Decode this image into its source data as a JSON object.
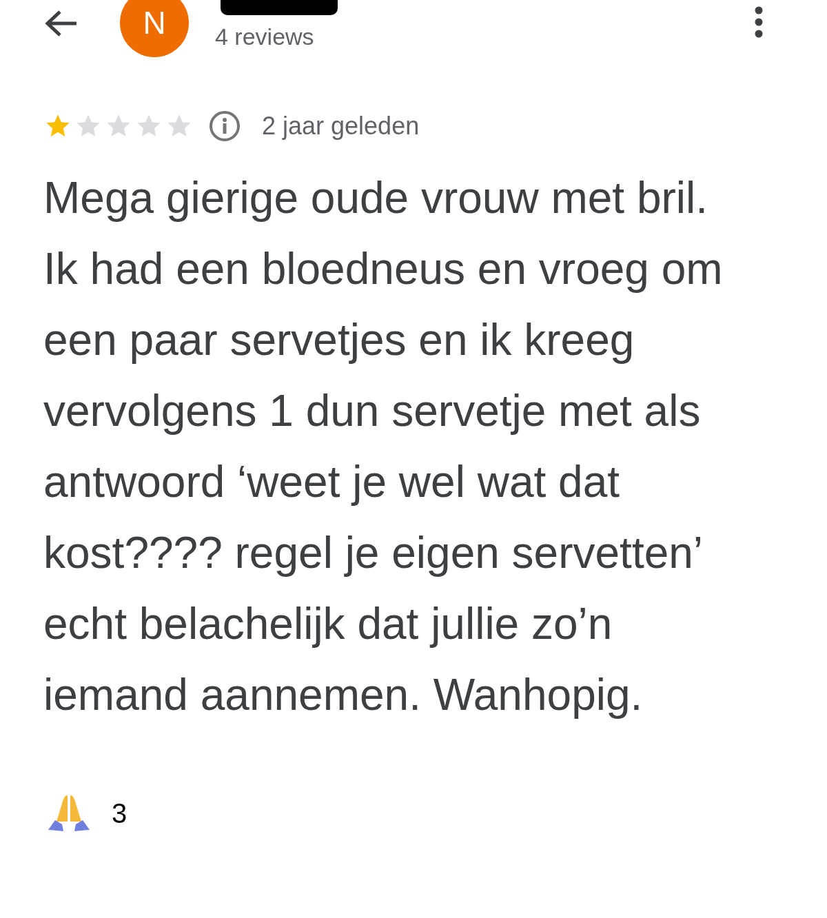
{
  "header": {
    "avatar_letter": "N",
    "review_count": "4 reviews"
  },
  "review": {
    "stars": 1,
    "time": "2 jaar geleden",
    "text": "Mega gierige oude vrouw met bril. Ik had een bloedneus en vroeg om een paar servetjes en ik kreeg vervolgens 1 dun servetje met als antwoord ‘weet je wel wat dat kost???? regel je eigen servetten’ echt belachelijk dat jullie zo’n iemand aannemen. Wanhopig."
  },
  "reactions": [
    {
      "count": "3"
    }
  ]
}
